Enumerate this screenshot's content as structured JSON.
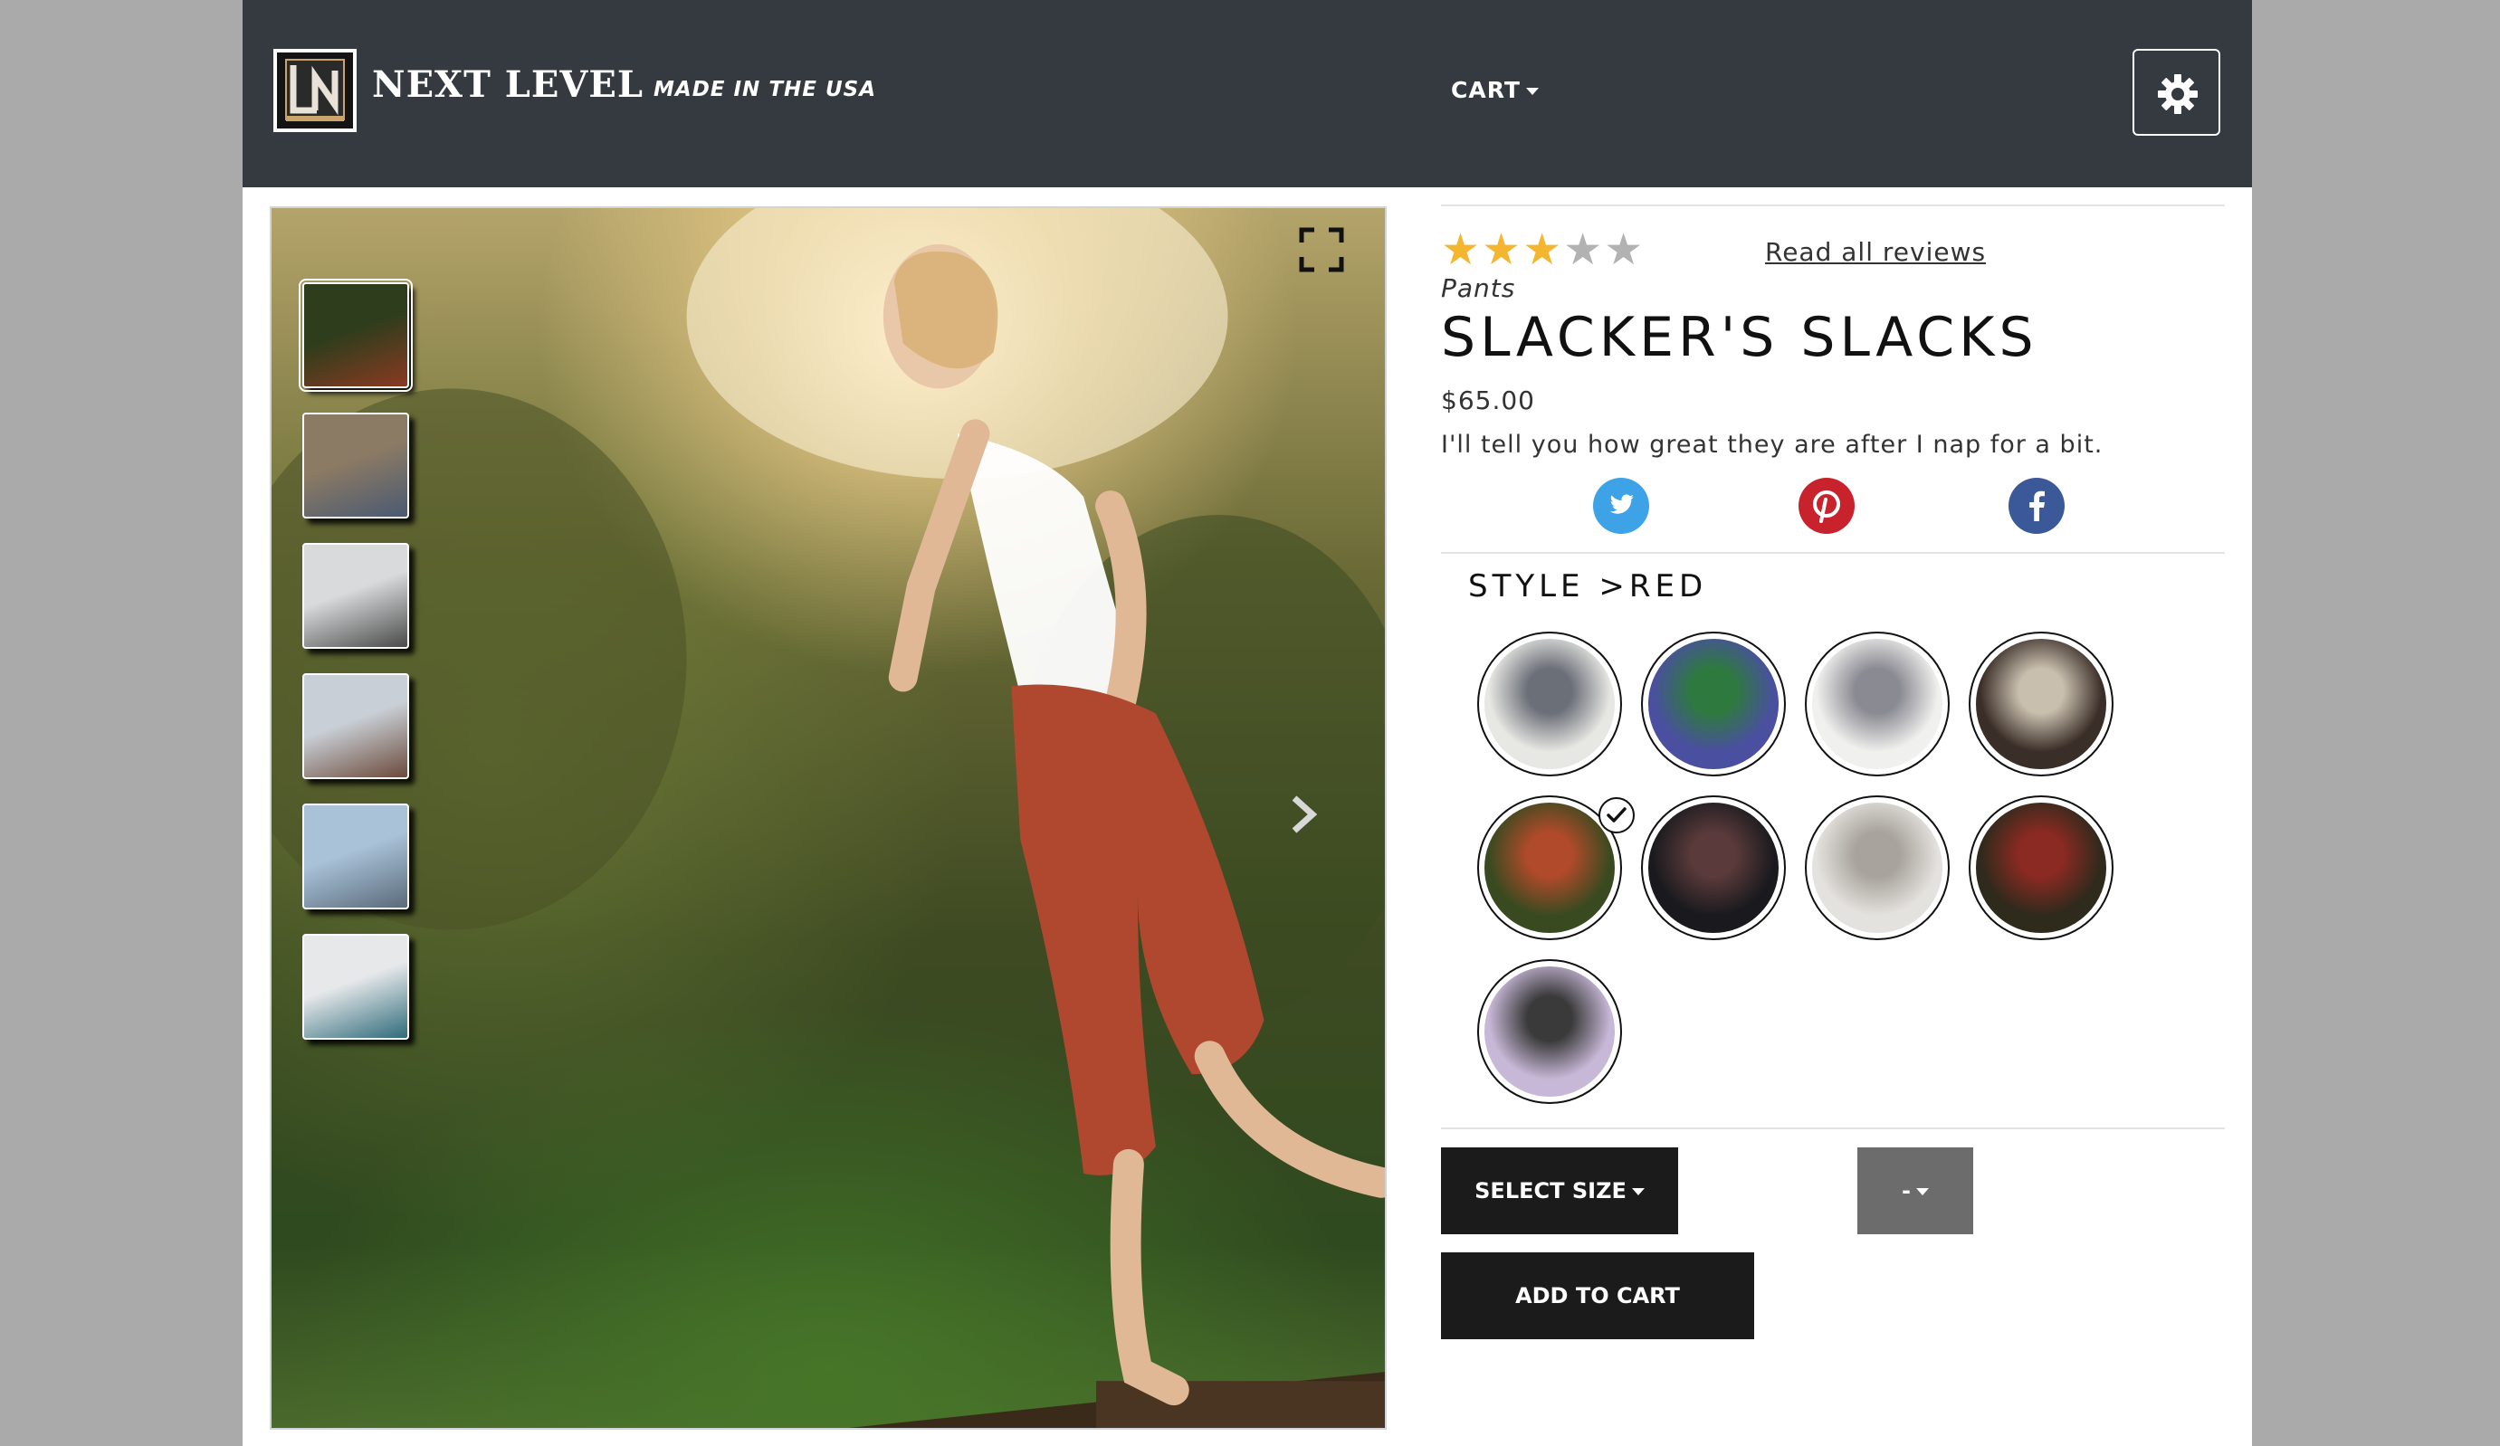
{
  "header": {
    "brand": "NEXT LEVEL",
    "tagline": "MADE IN THE USA",
    "cart_label": "CART",
    "logo_letters": "LN"
  },
  "gallery": {
    "thumbnails": [
      {
        "name": "thumb-girl-red-pants",
        "colors": [
          "#2e3d1c",
          "#8a3a22"
        ]
      },
      {
        "name": "thumb-office-group",
        "colors": [
          "#8b7a64",
          "#4a5a72"
        ]
      },
      {
        "name": "thumb-man-seaside",
        "colors": [
          "#d8dadb",
          "#4a4a4a"
        ]
      },
      {
        "name": "thumb-man-rooftop",
        "colors": [
          "#c9cfd6",
          "#6b4a3a"
        ]
      },
      {
        "name": "thumb-man-window",
        "colors": [
          "#a9c2d8",
          "#5a6b7a"
        ]
      },
      {
        "name": "thumb-man-sofa",
        "colors": [
          "#e6e8ea",
          "#2f6b7a"
        ]
      }
    ],
    "active_index": 0
  },
  "product": {
    "rating": 3,
    "rating_max": 5,
    "reviews_link": "Read all reviews",
    "category": "Pants",
    "title": "SLACKER'S SLACKS",
    "price": "$65.00",
    "description": "I'll tell you how great they are after I nap for a bit.",
    "social": [
      {
        "name": "twitter-icon",
        "color": "#3da3e6"
      },
      {
        "name": "pinterest-icon",
        "color": "#c8232c"
      },
      {
        "name": "facebook-icon",
        "color": "#3b5998"
      }
    ],
    "style_heading": "STYLE >RED",
    "styles": [
      {
        "name": "style-man-cafe",
        "colors": [
          "#e7e7e3",
          "#6b6f78"
        ]
      },
      {
        "name": "style-man-sitting-wall",
        "colors": [
          "#4a4fa0",
          "#2e7a3e"
        ]
      },
      {
        "name": "style-couple-street",
        "colors": [
          "#f0f0ee",
          "#8a8a92"
        ]
      },
      {
        "name": "style-shop-interior",
        "colors": [
          "#3a2e28",
          "#c9bfae"
        ]
      },
      {
        "name": "style-girl-red-pants",
        "colors": [
          "#3a4a20",
          "#b04a2a"
        ],
        "selected": true
      },
      {
        "name": "style-woman-car-night",
        "colors": [
          "#1a1a1e",
          "#5a3a3a"
        ]
      },
      {
        "name": "style-woman-white-outfit",
        "colors": [
          "#e4e2de",
          "#a8a39c"
        ]
      },
      {
        "name": "style-man-red-pants-dark",
        "colors": [
          "#2e2a1c",
          "#8a2a22"
        ]
      },
      {
        "name": "style-woman-graffiti",
        "colors": [
          "#c8b8d8",
          "#3a3a3a"
        ]
      }
    ],
    "size_button": "SELECT SIZE",
    "qty_button": "-",
    "add_to_cart": "ADD TO CART"
  },
  "colors": {
    "header_bg": "#343a40",
    "star_on": "#f4b630",
    "star_off": "#b2b2b2",
    "button_dark": "#1b1b1b",
    "button_gray": "#6c6c6c",
    "side_bg": "#aaaaaa"
  }
}
